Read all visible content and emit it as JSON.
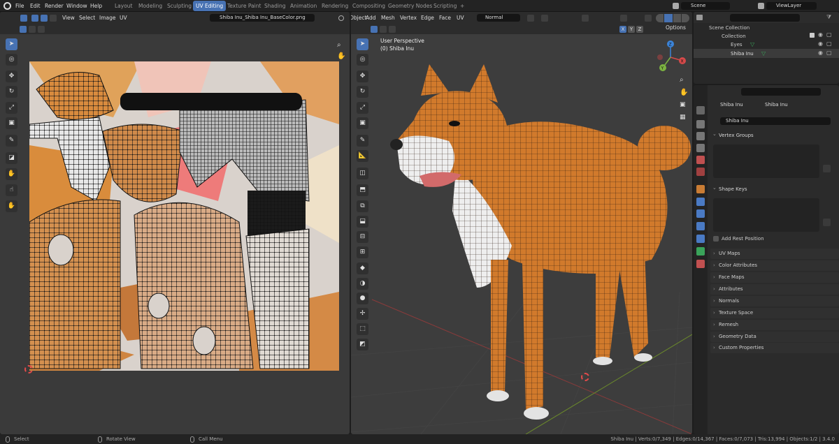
{
  "app": {
    "menus": [
      "File",
      "Edit",
      "Render",
      "Window",
      "Help"
    ],
    "workspaces": [
      "Layout",
      "Modeling",
      "Sculpting",
      "UV Editing",
      "Texture Paint",
      "Shading",
      "Animation",
      "Rendering",
      "Compositing",
      "Geometry Nodes",
      "Scripting",
      "+"
    ],
    "active_workspace": "UV Editing",
    "scene": "Scene",
    "view_layer": "ViewLayer"
  },
  "uv_editor": {
    "menus": [
      "View",
      "Select",
      "Image",
      "UV"
    ],
    "image_name": "Shiba Inu_Shiba Inu_BaseColor.png"
  },
  "viewport": {
    "menus": [
      "Object",
      "Add",
      "Mesh",
      "Vertex",
      "Edge",
      "Face",
      "UV"
    ],
    "shading_mode": "Normal",
    "options_label": "Options",
    "overlay_title": "User Perspective",
    "overlay_subtitle": "(0) Shiba Inu",
    "axes": {
      "x": "X",
      "y": "Y",
      "z": "Z"
    }
  },
  "outliner": {
    "root": "Scene Collection",
    "collection": "Collection",
    "items": [
      {
        "label": "Eyes"
      },
      {
        "label": "Shiba Inu"
      }
    ]
  },
  "properties": {
    "breadcrumb_object": "Shiba Inu",
    "breadcrumb_mesh": "Shiba Inu",
    "mesh_name": "Shiba Inu",
    "vertex_groups": "Vertex Groups",
    "shape_keys": "Shape Keys",
    "add_rest_position": "Add Rest Position",
    "collapsed": [
      "UV Maps",
      "Color Attributes",
      "Face Maps",
      "Attributes",
      "Normals",
      "Texture Space",
      "Remesh",
      "Geometry Data",
      "Custom Properties"
    ]
  },
  "status_bar": {
    "select": "Select",
    "rotate": "Rotate View",
    "call_menu": "Call Menu",
    "stats": "Shiba Inu | Verts:0/7,349 | Edges:0/14,367 | Faces:0/7,073 | Tris:13,994 | Objects:1/2 | 3.4.0"
  },
  "colors": {
    "accent": "#4772b3",
    "fur": "#d17a2c",
    "background": "#1d1d1d"
  }
}
